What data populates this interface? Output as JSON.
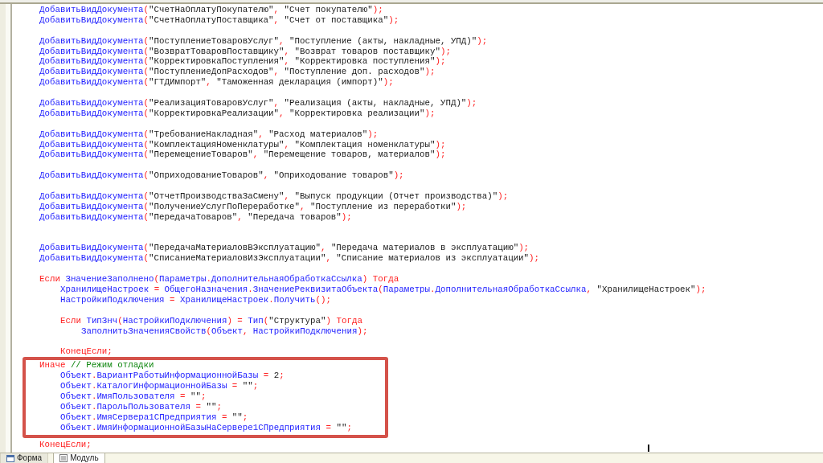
{
  "editor": {
    "lines": [
      {
        "kind": "code",
        "tokens": [
          {
            "kind": "name",
            "text": "ДобавитьВидДокумента"
          },
          {
            "kind": "operator",
            "text": "("
          },
          {
            "kind": "string",
            "text": "\"СчетНаОплатуПокупателю\""
          },
          {
            "kind": "operator",
            "text": ", "
          },
          {
            "kind": "string",
            "text": "\"Счет покупателю\""
          },
          {
            "kind": "operator",
            "text": ");"
          }
        ]
      },
      {
        "kind": "code",
        "tokens": [
          {
            "kind": "name",
            "text": "ДобавитьВидДокумента"
          },
          {
            "kind": "operator",
            "text": "("
          },
          {
            "kind": "string",
            "text": "\"СчетНаОплатуПоставщика\""
          },
          {
            "kind": "operator",
            "text": ", "
          },
          {
            "kind": "string",
            "text": "\"Счет от поставщика\""
          },
          {
            "kind": "operator",
            "text": ");"
          }
        ]
      },
      {
        "kind": "blank"
      },
      {
        "kind": "code",
        "tokens": [
          {
            "kind": "name",
            "text": "ДобавитьВидДокумента"
          },
          {
            "kind": "operator",
            "text": "("
          },
          {
            "kind": "string",
            "text": "\"ПоступлениеТоваровУслуг\""
          },
          {
            "kind": "operator",
            "text": ", "
          },
          {
            "kind": "string",
            "text": "\"Поступление (акты, накладные, УПД)\""
          },
          {
            "kind": "operator",
            "text": ");"
          }
        ]
      },
      {
        "kind": "code",
        "tokens": [
          {
            "kind": "name",
            "text": "ДобавитьВидДокумента"
          },
          {
            "kind": "operator",
            "text": "("
          },
          {
            "kind": "string",
            "text": "\"ВозвратТоваровПоставщику\""
          },
          {
            "kind": "operator",
            "text": ", "
          },
          {
            "kind": "string",
            "text": "\"Возврат товаров поставщику\""
          },
          {
            "kind": "operator",
            "text": ");"
          }
        ]
      },
      {
        "kind": "code",
        "tokens": [
          {
            "kind": "name",
            "text": "ДобавитьВидДокумента"
          },
          {
            "kind": "operator",
            "text": "("
          },
          {
            "kind": "string",
            "text": "\"КорректировкаПоступления\""
          },
          {
            "kind": "operator",
            "text": ", "
          },
          {
            "kind": "string",
            "text": "\"Корректировка поступления\""
          },
          {
            "kind": "operator",
            "text": ");"
          }
        ]
      },
      {
        "kind": "code",
        "tokens": [
          {
            "kind": "name",
            "text": "ДобавитьВидДокумента"
          },
          {
            "kind": "operator",
            "text": "("
          },
          {
            "kind": "string",
            "text": "\"ПоступлениеДопРасходов\""
          },
          {
            "kind": "operator",
            "text": ", "
          },
          {
            "kind": "string",
            "text": "\"Поступление доп. расходов\""
          },
          {
            "kind": "operator",
            "text": ");"
          }
        ]
      },
      {
        "kind": "code",
        "tokens": [
          {
            "kind": "name",
            "text": "ДобавитьВидДокумента"
          },
          {
            "kind": "operator",
            "text": "("
          },
          {
            "kind": "string",
            "text": "\"ГТДИмпорт\""
          },
          {
            "kind": "operator",
            "text": ", "
          },
          {
            "kind": "string",
            "text": "\"Таможенная декларация (импорт)\""
          },
          {
            "kind": "operator",
            "text": ");"
          }
        ]
      },
      {
        "kind": "blank"
      },
      {
        "kind": "code",
        "tokens": [
          {
            "kind": "name",
            "text": "ДобавитьВидДокумента"
          },
          {
            "kind": "operator",
            "text": "("
          },
          {
            "kind": "string",
            "text": "\"РеализацияТоваровУслуг\""
          },
          {
            "kind": "operator",
            "text": ", "
          },
          {
            "kind": "string",
            "text": "\"Реализация (акты, накладные, УПД)\""
          },
          {
            "kind": "operator",
            "text": ");"
          }
        ]
      },
      {
        "kind": "code",
        "tokens": [
          {
            "kind": "name",
            "text": "ДобавитьВидДокумента"
          },
          {
            "kind": "operator",
            "text": "("
          },
          {
            "kind": "string",
            "text": "\"КорректировкаРеализации\""
          },
          {
            "kind": "operator",
            "text": ", "
          },
          {
            "kind": "string",
            "text": "\"Корректировка реализации\""
          },
          {
            "kind": "operator",
            "text": ");"
          }
        ]
      },
      {
        "kind": "blank"
      },
      {
        "kind": "code",
        "tokens": [
          {
            "kind": "name",
            "text": "ДобавитьВидДокумента"
          },
          {
            "kind": "operator",
            "text": "("
          },
          {
            "kind": "string",
            "text": "\"ТребованиеНакладная\""
          },
          {
            "kind": "operator",
            "text": ", "
          },
          {
            "kind": "string",
            "text": "\"Расход материалов\""
          },
          {
            "kind": "operator",
            "text": ");"
          }
        ]
      },
      {
        "kind": "code",
        "tokens": [
          {
            "kind": "name",
            "text": "ДобавитьВидДокумента"
          },
          {
            "kind": "operator",
            "text": "("
          },
          {
            "kind": "string",
            "text": "\"КомплектацияНоменклатуры\""
          },
          {
            "kind": "operator",
            "text": ", "
          },
          {
            "kind": "string",
            "text": "\"Комплектация номенклатуры\""
          },
          {
            "kind": "operator",
            "text": ");"
          }
        ]
      },
      {
        "kind": "code",
        "tokens": [
          {
            "kind": "name",
            "text": "ДобавитьВидДокумента"
          },
          {
            "kind": "operator",
            "text": "("
          },
          {
            "kind": "string",
            "text": "\"ПеремещениеТоваров\""
          },
          {
            "kind": "operator",
            "text": ", "
          },
          {
            "kind": "string",
            "text": "\"Перемещение товаров, материалов\""
          },
          {
            "kind": "operator",
            "text": ");"
          }
        ]
      },
      {
        "kind": "blank"
      },
      {
        "kind": "code",
        "tokens": [
          {
            "kind": "name",
            "text": "ДобавитьВидДокумента"
          },
          {
            "kind": "operator",
            "text": "("
          },
          {
            "kind": "string",
            "text": "\"ОприходованиеТоваров\""
          },
          {
            "kind": "operator",
            "text": ", "
          },
          {
            "kind": "string",
            "text": "\"Оприходование товаров\""
          },
          {
            "kind": "operator",
            "text": ");"
          }
        ]
      },
      {
        "kind": "blank"
      },
      {
        "kind": "code",
        "tokens": [
          {
            "kind": "name",
            "text": "ДобавитьВидДокумента"
          },
          {
            "kind": "operator",
            "text": "("
          },
          {
            "kind": "string",
            "text": "\"ОтчетПроизводстваЗаСмену\""
          },
          {
            "kind": "operator",
            "text": ", "
          },
          {
            "kind": "string",
            "text": "\"Выпуск продукции (Отчет производства)\""
          },
          {
            "kind": "operator",
            "text": ");"
          }
        ]
      },
      {
        "kind": "code",
        "tokens": [
          {
            "kind": "name",
            "text": "ДобавитьВидДокумента"
          },
          {
            "kind": "operator",
            "text": "("
          },
          {
            "kind": "string",
            "text": "\"ПолучениеУслугПоПереработке\""
          },
          {
            "kind": "operator",
            "text": ", "
          },
          {
            "kind": "string",
            "text": "\"Поступление из переработки\""
          },
          {
            "kind": "operator",
            "text": ");"
          }
        ]
      },
      {
        "kind": "code",
        "tokens": [
          {
            "kind": "name",
            "text": "ДобавитьВидДокумента"
          },
          {
            "kind": "operator",
            "text": "("
          },
          {
            "kind": "string",
            "text": "\"ПередачаТоваров\""
          },
          {
            "kind": "operator",
            "text": ", "
          },
          {
            "kind": "string",
            "text": "\"Передача товаров\""
          },
          {
            "kind": "operator",
            "text": ");"
          }
        ]
      },
      {
        "kind": "blank"
      },
      {
        "kind": "blank"
      },
      {
        "kind": "code",
        "tokens": [
          {
            "kind": "name",
            "text": "ДобавитьВидДокумента"
          },
          {
            "kind": "operator",
            "text": "("
          },
          {
            "kind": "string",
            "text": "\"ПередачаМатериаловВЭксплуатацию\""
          },
          {
            "kind": "operator",
            "text": ", "
          },
          {
            "kind": "string",
            "text": "\"Передача материалов в эксплуатацию\""
          },
          {
            "kind": "operator",
            "text": ");"
          }
        ]
      },
      {
        "kind": "code",
        "tokens": [
          {
            "kind": "name",
            "text": "ДобавитьВидДокумента"
          },
          {
            "kind": "operator",
            "text": "("
          },
          {
            "kind": "string",
            "text": "\"СписаниеМатериаловИзЭксплуатации\""
          },
          {
            "kind": "operator",
            "text": ", "
          },
          {
            "kind": "string",
            "text": "\"Списание материалов из эксплуатации\""
          },
          {
            "kind": "operator",
            "text": ");"
          }
        ]
      },
      {
        "kind": "blank"
      },
      {
        "kind": "code",
        "tokens": [
          {
            "kind": "keyword",
            "text": "Если "
          },
          {
            "kind": "name",
            "text": "ЗначениеЗаполнено"
          },
          {
            "kind": "operator",
            "text": "("
          },
          {
            "kind": "name",
            "text": "Параметры"
          },
          {
            "kind": "operator",
            "text": "."
          },
          {
            "kind": "name",
            "text": "ДополнительнаяОбработкаСсылка"
          },
          {
            "kind": "operator",
            "text": ") "
          },
          {
            "kind": "keyword",
            "text": "Тогда"
          }
        ],
        "children": [
          {
            "kind": "code",
            "tokens": [
              {
                "kind": "name",
                "text": "ХранилищеНастроек"
              },
              {
                "kind": "operator",
                "text": " = "
              },
              {
                "kind": "name",
                "text": "ОбщегоНазначения"
              },
              {
                "kind": "operator",
                "text": "."
              },
              {
                "kind": "name",
                "text": "ЗначениеРеквизитаОбъекта"
              },
              {
                "kind": "operator",
                "text": "("
              },
              {
                "kind": "name",
                "text": "Параметры"
              },
              {
                "kind": "operator",
                "text": "."
              },
              {
                "kind": "name",
                "text": "ДополнительнаяОбработкаСсылка"
              },
              {
                "kind": "operator",
                "text": ", "
              },
              {
                "kind": "string",
                "text": "\"ХранилищеНастроек\""
              },
              {
                "kind": "operator",
                "text": ");"
              }
            ]
          },
          {
            "kind": "code",
            "tokens": [
              {
                "kind": "name",
                "text": "НастройкиПодключения"
              },
              {
                "kind": "operator",
                "text": " = "
              },
              {
                "kind": "name",
                "text": "ХранилищеНастроек"
              },
              {
                "kind": "operator",
                "text": "."
              },
              {
                "kind": "name",
                "text": "Получить"
              },
              {
                "kind": "operator",
                "text": "();"
              }
            ]
          },
          {
            "kind": "blank"
          },
          {
            "kind": "code",
            "tokens": [
              {
                "kind": "keyword",
                "text": "Если "
              },
              {
                "kind": "name",
                "text": "ТипЗнч"
              },
              {
                "kind": "operator",
                "text": "("
              },
              {
                "kind": "name",
                "text": "НастройкиПодключения"
              },
              {
                "kind": "operator",
                "text": ") = "
              },
              {
                "kind": "name",
                "text": "Тип"
              },
              {
                "kind": "operator",
                "text": "("
              },
              {
                "kind": "string",
                "text": "\"Структура\""
              },
              {
                "kind": "operator",
                "text": ") "
              },
              {
                "kind": "keyword",
                "text": "Тогда"
              }
            ],
            "children": [
              {
                "kind": "code",
                "tokens": [
                  {
                    "kind": "name",
                    "text": "ЗаполнитьЗначенияСвойств"
                  },
                  {
                    "kind": "operator",
                    "text": "("
                  },
                  {
                    "kind": "name",
                    "text": "Объект"
                  },
                  {
                    "kind": "operator",
                    "text": ", "
                  },
                  {
                    "kind": "name",
                    "text": "НастройкиПодключения"
                  },
                  {
                    "kind": "operator",
                    "text": ");"
                  }
                ]
              },
              {
                "kind": "blank"
              }
            ]
          },
          {
            "kind": "code",
            "tokens": [
              {
                "kind": "keyword",
                "text": "КонецЕсли;"
              }
            ]
          }
        ]
      },
      {
        "kind": "highlight",
        "lines": [
          {
            "kind": "code",
            "tokens": [
              {
                "kind": "keyword",
                "text": "Иначе "
              },
              {
                "kind": "comment",
                "text": "// Режим отладки"
              }
            ],
            "children": [
              {
                "kind": "code",
                "tokens": [
                  {
                    "kind": "name",
                    "text": "Объект"
                  },
                  {
                    "kind": "operator",
                    "text": "."
                  },
                  {
                    "kind": "name",
                    "text": "ВариантРаботыИнформационнойБазы"
                  },
                  {
                    "kind": "operator",
                    "text": " = "
                  },
                  {
                    "kind": "number",
                    "text": "2"
                  },
                  {
                    "kind": "operator",
                    "text": ";"
                  }
                ]
              },
              {
                "kind": "code",
                "tokens": [
                  {
                    "kind": "name",
                    "text": "Объект"
                  },
                  {
                    "kind": "operator",
                    "text": "."
                  },
                  {
                    "kind": "name",
                    "text": "КаталогИнформационнойБазы"
                  },
                  {
                    "kind": "operator",
                    "text": " = "
                  },
                  {
                    "kind": "string",
                    "text": "\"\""
                  },
                  {
                    "kind": "operator",
                    "text": ";"
                  }
                ]
              },
              {
                "kind": "code",
                "tokens": [
                  {
                    "kind": "name",
                    "text": "Объект"
                  },
                  {
                    "kind": "operator",
                    "text": "."
                  },
                  {
                    "kind": "name",
                    "text": "ИмяПользователя"
                  },
                  {
                    "kind": "operator",
                    "text": " = "
                  },
                  {
                    "kind": "string",
                    "text": "\"\""
                  },
                  {
                    "kind": "operator",
                    "text": ";"
                  }
                ]
              },
              {
                "kind": "code",
                "tokens": [
                  {
                    "kind": "name",
                    "text": "Объект"
                  },
                  {
                    "kind": "operator",
                    "text": "."
                  },
                  {
                    "kind": "name",
                    "text": "ПарольПользователя"
                  },
                  {
                    "kind": "operator",
                    "text": " = "
                  },
                  {
                    "kind": "string",
                    "text": "\"\""
                  },
                  {
                    "kind": "operator",
                    "text": ";"
                  }
                ]
              },
              {
                "kind": "code",
                "tokens": [
                  {
                    "kind": "name",
                    "text": "Объект"
                  },
                  {
                    "kind": "operator",
                    "text": "."
                  },
                  {
                    "kind": "name",
                    "text": "ИмяСервера1СПредприятия"
                  },
                  {
                    "kind": "operator",
                    "text": " = "
                  },
                  {
                    "kind": "string",
                    "text": "\"\""
                  },
                  {
                    "kind": "operator",
                    "text": ";"
                  }
                ]
              },
              {
                "kind": "code",
                "tokens": [
                  {
                    "kind": "name",
                    "text": "Объект"
                  },
                  {
                    "kind": "operator",
                    "text": "."
                  },
                  {
                    "kind": "name",
                    "text": "ИмяИнформационнойБазыНаСервере1СПредприятия"
                  },
                  {
                    "kind": "operator",
                    "text": " = "
                  },
                  {
                    "kind": "string",
                    "text": "\"\""
                  },
                  {
                    "kind": "operator",
                    "text": ";"
                  }
                ]
              }
            ]
          }
        ]
      },
      {
        "kind": "code",
        "tokens": [
          {
            "kind": "keyword",
            "text": "КонецЕсли;"
          }
        ]
      }
    ]
  },
  "tabs": [
    {
      "label": "Форма",
      "selected": false
    },
    {
      "label": "Модуль",
      "selected": true
    }
  ]
}
